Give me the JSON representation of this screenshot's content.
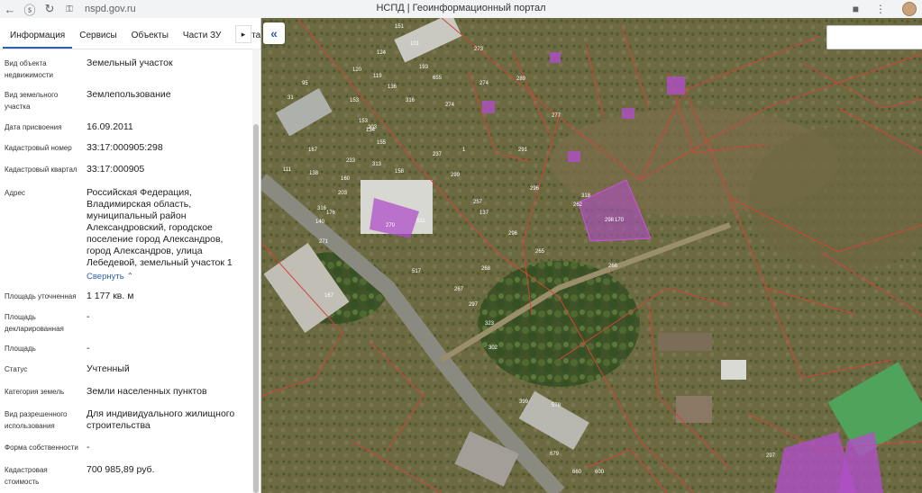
{
  "browser": {
    "url": "nspd.gov.ru",
    "page_title": "НСПД | Геоинформационный портал"
  },
  "tabs": [
    "Информация",
    "Сервисы",
    "Объекты",
    "Части ЗУ",
    "Соста"
  ],
  "info": [
    {
      "label": "Вид объекта недвижимости",
      "value": "Земельный участок"
    },
    {
      "label": "Вид земельного участка",
      "value": "Землепользование"
    },
    {
      "label": "Дата присвоения",
      "value": "16.09.2011"
    },
    {
      "label": "Кадастровый номер",
      "value": "33:17:000905:298"
    },
    {
      "label": "Кадастровый квартал",
      "value": "33:17:000905"
    },
    {
      "label": "Адрес",
      "value": "Российская Федерация, Владимирская область, муниципальный район Александровский, городское поселение город Александров, город Александров, улица Лебедевой, земельный участок 1"
    },
    {
      "label": "Площадь уточненная",
      "value": "1 177 кв. м"
    },
    {
      "label": "Площадь декларированная",
      "value": "-"
    },
    {
      "label": "Площадь",
      "value": "-"
    },
    {
      "label": "Статус",
      "value": "Учтенный"
    },
    {
      "label": "Категория земель",
      "value": "Земли населенных пунктов"
    },
    {
      "label": "Вид разрешенного использования",
      "value": "Для индивидуального жилищного строительства"
    },
    {
      "label": "Форма собственности",
      "value": "-"
    },
    {
      "label": "Кадастровая стоимость",
      "value": "700 985,89 руб."
    }
  ],
  "collapse_link": "Свернуть",
  "map": {
    "parcel_labels": [
      "151",
      "101",
      "124",
      "273",
      "120",
      "193",
      "119",
      "655",
      "136",
      "274",
      "289",
      "95",
      "31",
      "316",
      "153",
      "153",
      "274",
      "277",
      "134",
      "203",
      "167",
      "313",
      "155",
      "237",
      "158",
      "299",
      "291",
      "1",
      "111",
      "233",
      "137",
      "138",
      "160",
      "257",
      "296",
      "203",
      "316",
      "176",
      "170",
      "296",
      "270",
      "140",
      "298",
      "271",
      "266",
      "262",
      "265",
      "318",
      "511",
      "517",
      "267",
      "268",
      "297",
      "323",
      "302",
      "399",
      "578",
      "167",
      "679",
      "660",
      "600",
      "297"
    ],
    "colors": {
      "parcel_border": "#d2443a",
      "selected_fill": "#b04fc8"
    }
  }
}
